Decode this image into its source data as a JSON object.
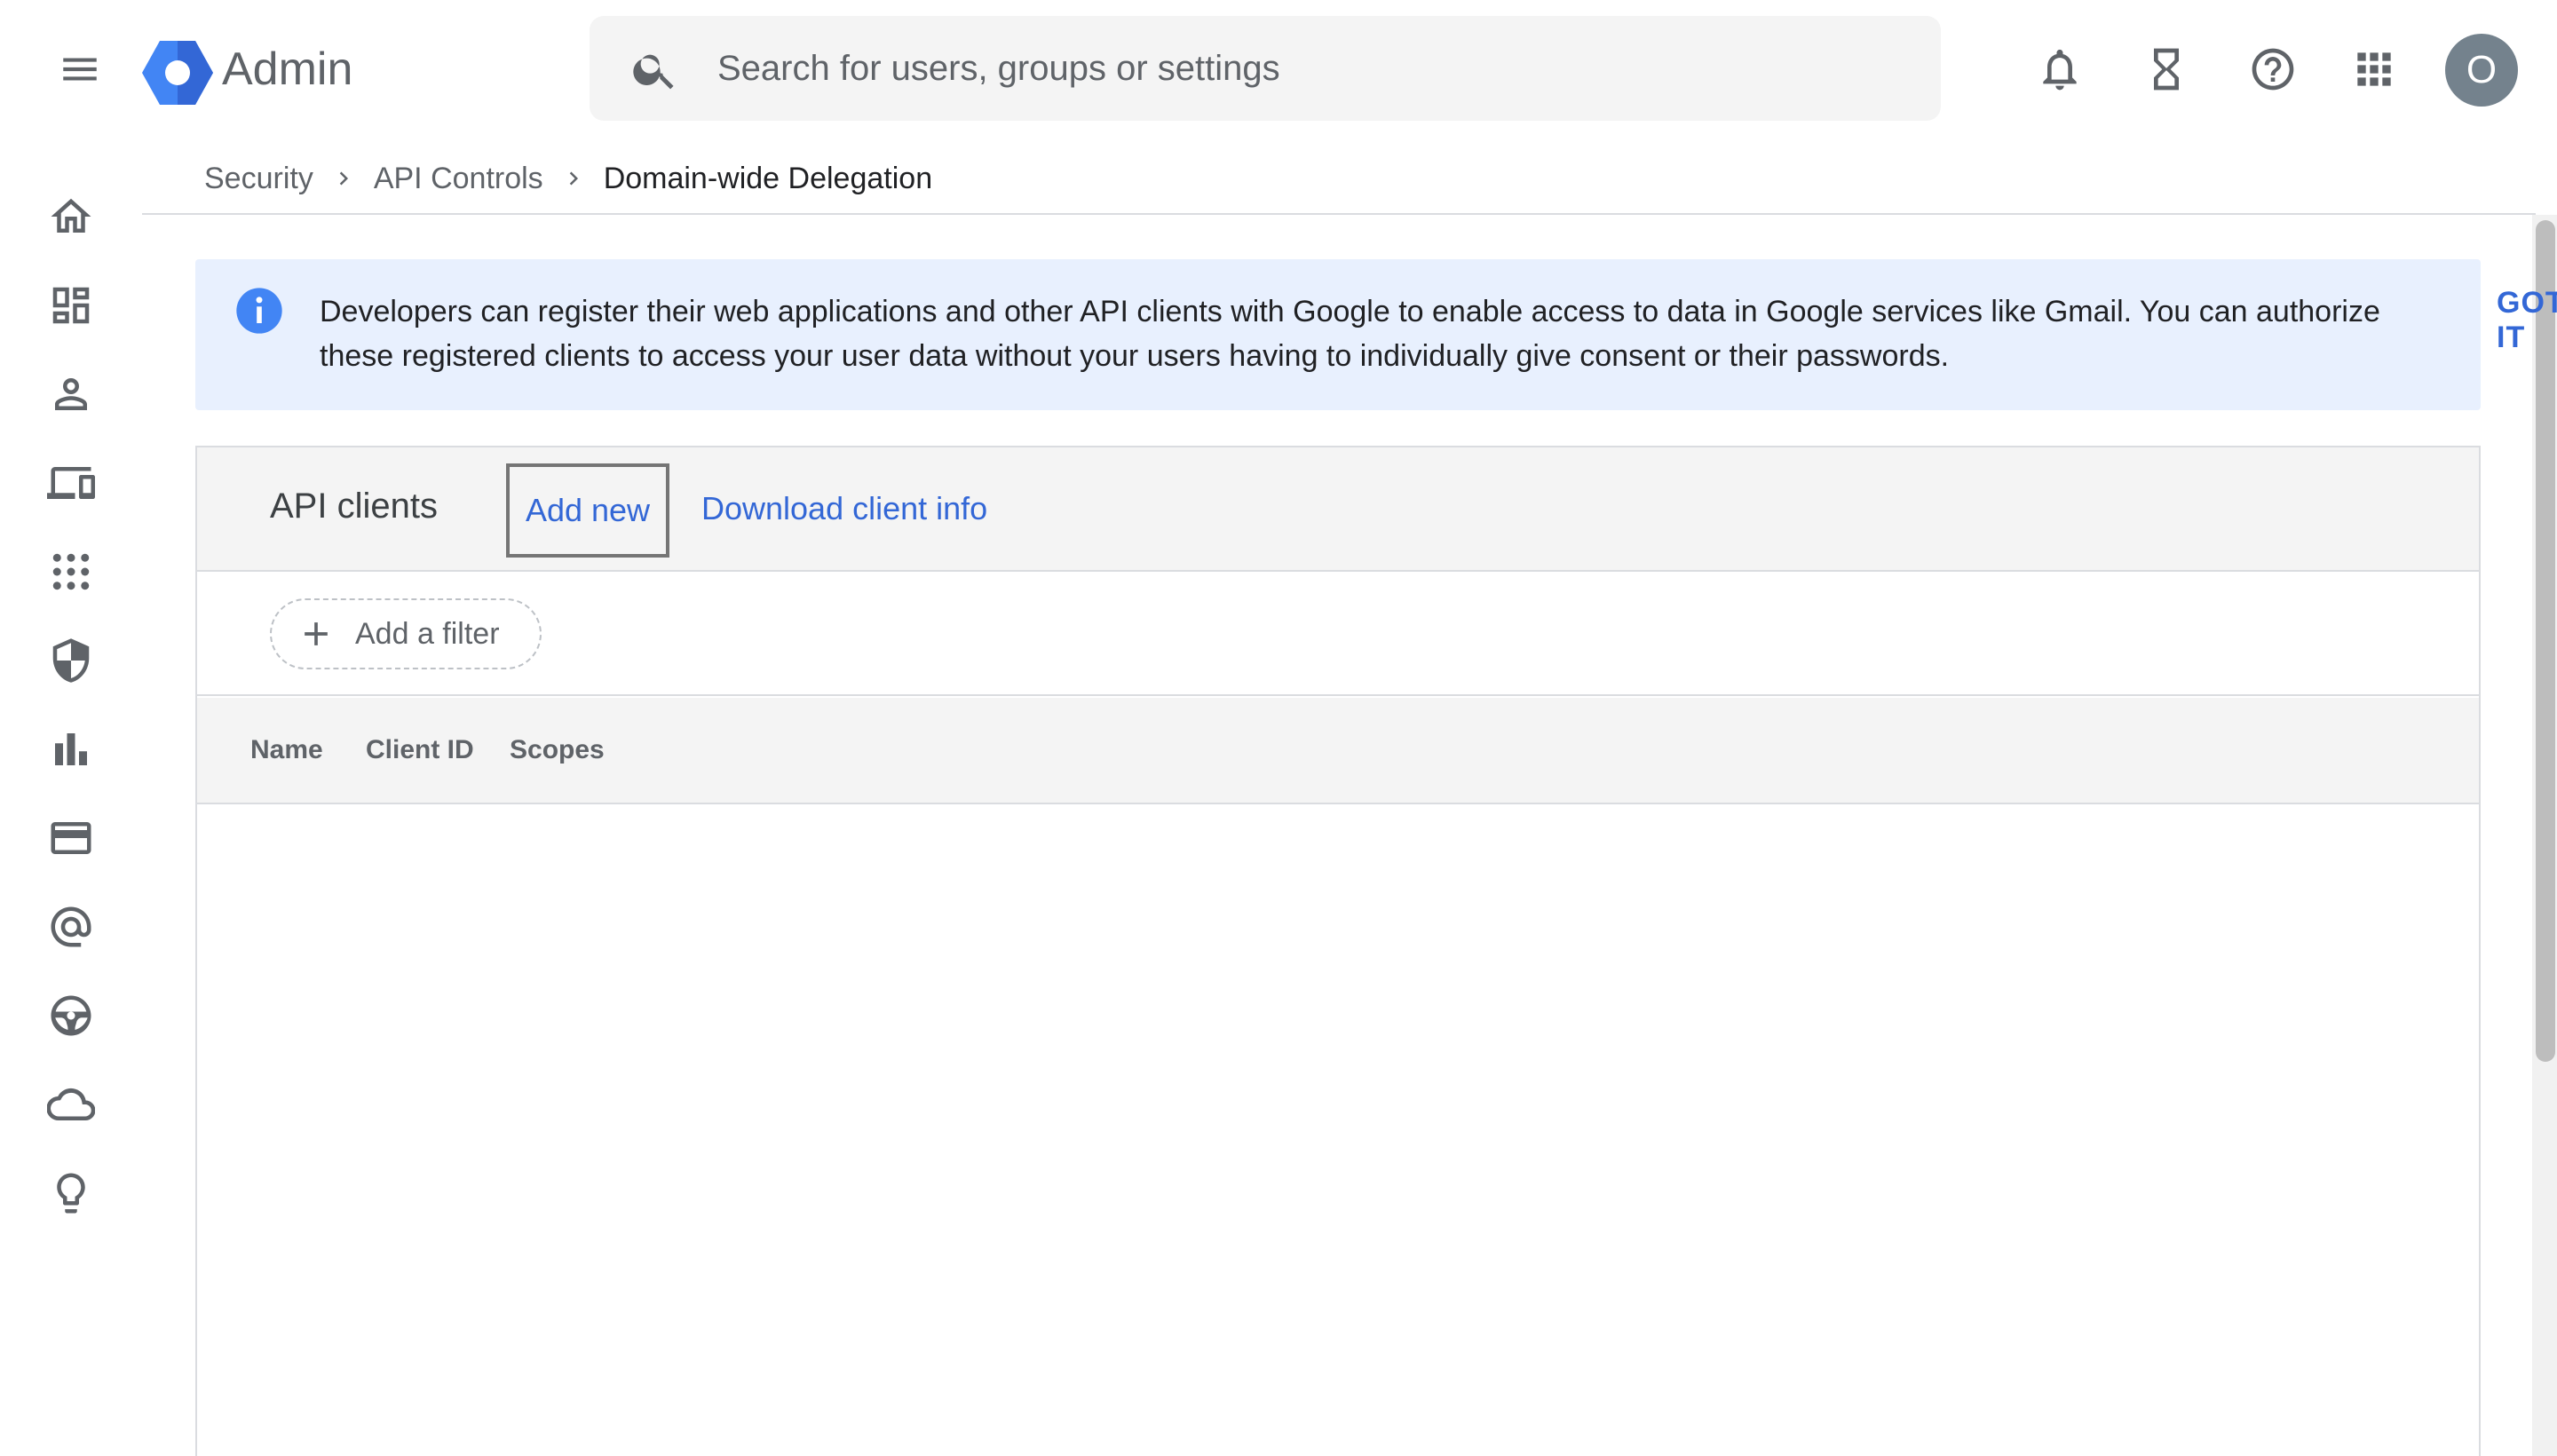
{
  "app": {
    "name": "Admin"
  },
  "search": {
    "placeholder": "Search for users, groups or settings"
  },
  "topbar": {
    "icons": [
      "notifications-icon",
      "hourglass-icon",
      "help-icon",
      "apps-icon"
    ],
    "avatar_initial": "O"
  },
  "rail": {
    "items": [
      "home-icon",
      "dashboard-icon",
      "user-icon",
      "devices-icon",
      "apps-icon",
      "security-icon",
      "reporting-icon",
      "billing-icon",
      "account-icon",
      "rules-icon",
      "storage-icon",
      "insights-icon"
    ]
  },
  "breadcrumb": {
    "items": [
      "Security",
      "API Controls",
      "Domain-wide Delegation"
    ]
  },
  "banner": {
    "text": "Developers can register their web applications and other API clients with Google to enable access to data in Google services like Gmail. You can authorize these registered clients to access your user data without your users having to individually give consent or their passwords.",
    "action": "GOT IT"
  },
  "panel": {
    "title": "API clients",
    "add_new": "Add new",
    "download": "Download client info",
    "filter_label": "Add a filter",
    "columns": [
      "Name",
      "Client ID",
      "Scopes"
    ]
  },
  "colors": {
    "accent": "#3367d6",
    "banner_bg": "#e8f0fe",
    "header_bg": "#f4f4f4",
    "avatar_bg": "#74828d"
  }
}
